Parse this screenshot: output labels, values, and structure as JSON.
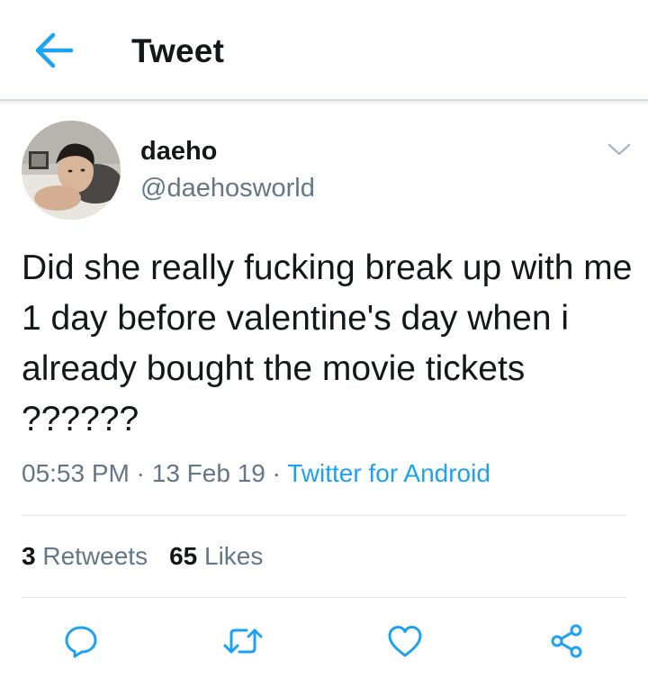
{
  "header": {
    "title": "Tweet",
    "back_icon": "arrow-left-icon",
    "accent_color": "#1da1f2"
  },
  "tweet": {
    "author": {
      "display_name": "daeho",
      "handle": "@daehosworld",
      "avatar_icon": "profile-photo"
    },
    "text": "Did she really fucking break up with me 1 day before valentine's day when i already bought the movie tickets ??????",
    "time": "05:53 PM",
    "separator": " · ",
    "date": "13 Feb 19",
    "source": "Twitter for Android",
    "stats": {
      "retweets_count": "3",
      "retweets_label": "Retweets",
      "likes_count": "65",
      "likes_label": "Likes"
    },
    "actions": [
      "reply-icon",
      "retweet-icon",
      "like-icon",
      "share-icon"
    ],
    "menu_icon": "chevron-down-icon"
  },
  "colors": {
    "text_primary": "#14171a",
    "text_secondary": "#657786",
    "link": "#1da1f2",
    "divider": "#dfe4e8"
  }
}
